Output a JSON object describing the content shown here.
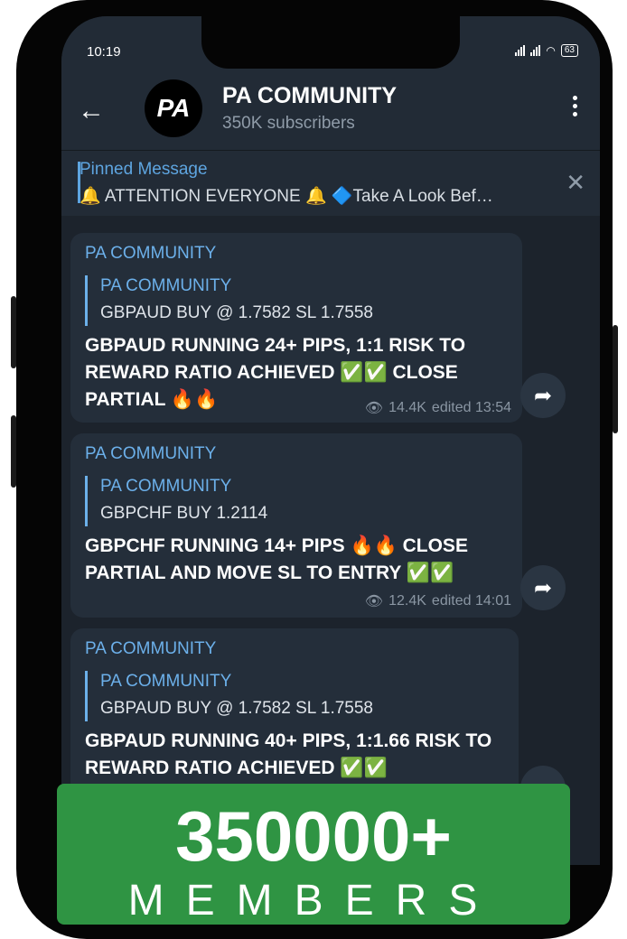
{
  "status": {
    "time": "10:19",
    "battery": "63"
  },
  "header": {
    "avatar": "PA",
    "title": "PA COMMUNITY",
    "subtitle": "350K subscribers"
  },
  "pinned": {
    "title": "Pinned Message",
    "text": "🔔 ATTENTION EVERYONE 🔔  🔷Take A Look Bef…"
  },
  "messages": [
    {
      "author": "PA COMMUNITY",
      "quote_author": "PA COMMUNITY",
      "quote_text": "GBPAUD BUY @ 1.7582 SL 1.7558",
      "body": "GBPAUD RUNNING 24+ PIPS, 1:1 RISK TO REWARD RATIO ACHIEVED ✅✅ CLOSE PARTIAL 🔥🔥",
      "views": "14.4K",
      "edited": "edited 13:54"
    },
    {
      "author": "PA COMMUNITY",
      "quote_author": "PA COMMUNITY",
      "quote_text": "GBPCHF BUY 1.2114",
      "body": "GBPCHF RUNNING 14+ PIPS 🔥🔥 CLOSE PARTIAL AND MOVE SL TO ENTRY ✅✅",
      "views": "12.4K",
      "edited": "edited 14:01"
    },
    {
      "author": "PA COMMUNITY",
      "quote_author": "PA COMMUNITY",
      "quote_text": "GBPAUD BUY @ 1.7582 SL 1.7558",
      "body": "GBPAUD RUNNING 40+ PIPS, 1:1.66 RISK TO REWARD RATIO ACHIEVED ✅✅"
    }
  ],
  "banner": {
    "count": "350000+",
    "label": "MEMBERS"
  },
  "colors": {
    "banner": "#2f9443",
    "accent": "#6cb0ea",
    "background": "#1c232c"
  }
}
